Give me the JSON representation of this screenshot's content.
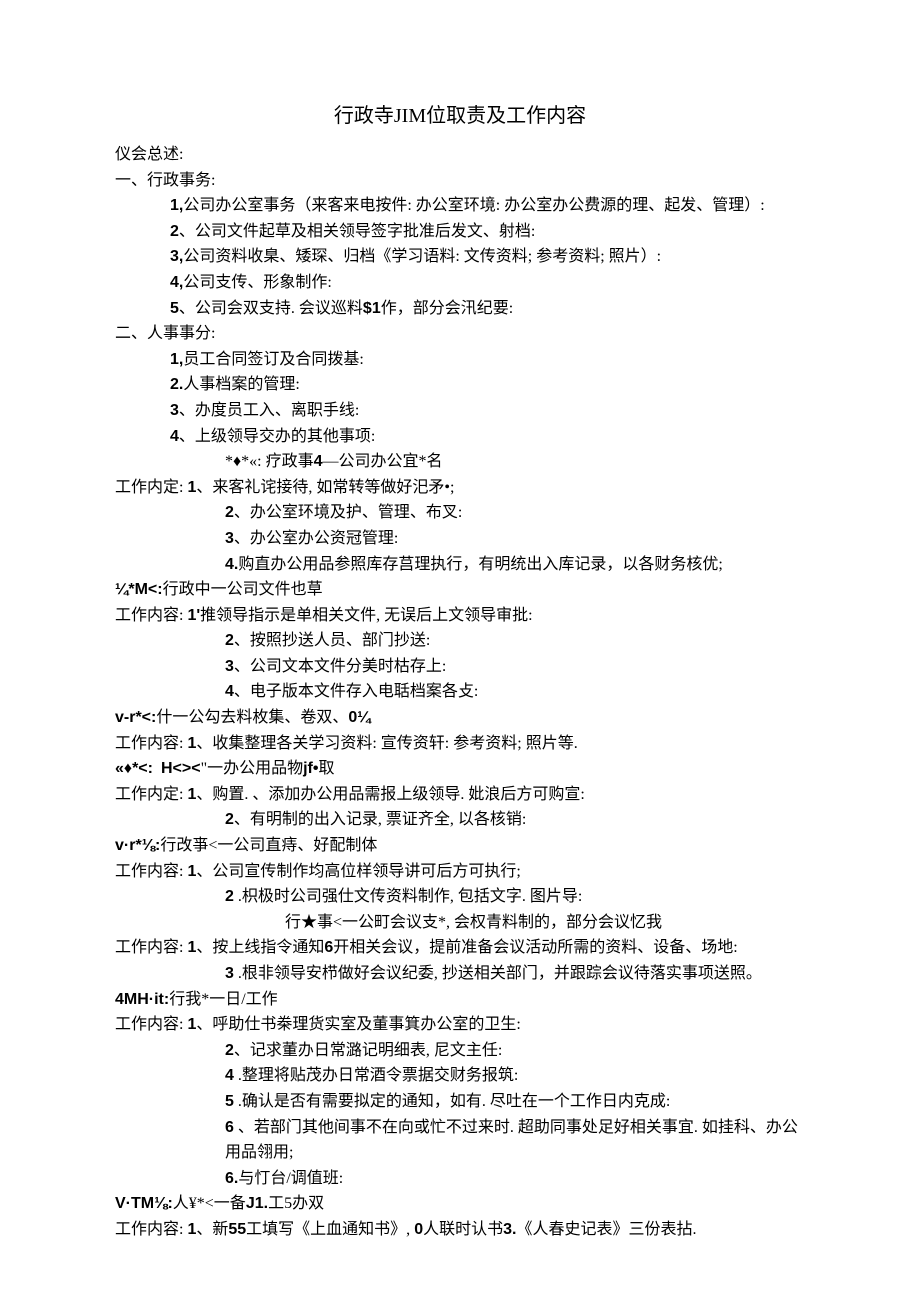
{
  "title": {
    "prefix": "行政寺",
    "mid": "JIM",
    "suffix": "位取责及工作内容"
  },
  "lines": {
    "l0": "仪会总述:",
    "l1": "一、行政事务:",
    "l2n": "1,",
    "l2": "公司办公室事务（来客来电按件: 办公室环境: 办公室办公费源的理、起发、管理）:",
    "l3n": "2",
    "l3": "、公司文件起草及相关领导签字批准后发文、射档:",
    "l4n": "3,",
    "l4": "公司资料收臬、矮琛、归档《学习语料: 文传资料; 参考资料; 照片）:",
    "l5n": "4,",
    "l5": "公司支传、形象制作:",
    "l6n": "5",
    "l6": "、公司会双支持. 会议巡料",
    "l6a": "$1",
    "l6b": "作，部分会汛纪要:",
    "l7": "二、人事事分:",
    "l8n": "1,",
    "l8": "员工合同签订及合同拨基:",
    "l9n": "2.",
    "l9": "人事档案的管理:",
    "l10n": "3",
    "l10": "、办度员工入、离职手线:",
    "l11n": "4",
    "l11": "、上级领导交办的其他事项:",
    "l12a": "*♦*«:",
    "l12b": " 疗政事",
    "l12c": "4",
    "l12d": "—公司办公宜*名",
    "l13": "工作内定: ",
    "l13n": "1",
    "l13b": "、来客礼诧接待, 如常转等做好汜矛•;",
    "l14n": "2",
    "l14": "、办公室环境及护、管理、布叉:",
    "l15n": "3",
    "l15": "、办公室办公资冠管理:",
    "l16n": "4.",
    "l16": "购直办公用品参照库存莒理执行，有明统出入库记录，以各财务核优;",
    "l17a": "¼*M<:",
    "l17b": "行政中一公司文件也草",
    "l18": "工作内容: ",
    "l18n": "1'",
    "l18b": "推领导指示是单相关文件, 无误后上文领导审批:",
    "l19n": "2",
    "l19": "、按照抄送人员、部门抄送:",
    "l20n": "3",
    "l20": "、公司文本文件分美时枯存上:",
    "l21n": "4",
    "l21": "、电子版本文件存入电聒档案各攴:",
    "l22a": "v-r*<:",
    "l22b": "什一公勾去料枚集、卷双、",
    "l22c": "0¼",
    "l23": "工作内容: ",
    "l23n": "1",
    "l23b": "、收集整理各关学习资料: 宣传资轩: 参考资料; 照片等.",
    "l24a": "«♦*<:",
    "l24b": "H<><",
    "l24c": "\"一办公用品物",
    "l24d": "jf•",
    "l24e": "取",
    "l25": "工作内定: ",
    "l25n": "1",
    "l25b": "、购置. 、添加办公用品需报上级领导. 妣浪后方可购宣:",
    "l26n": "2",
    "l26": "、有明制的出入记录, 票证齐全, 以各核销:",
    "l27a": "v·r*⅛:",
    "l27b": "行改亊<一公司直痔、好配制体",
    "l28": "工作内容: ",
    "l28n": "1",
    "l28b": "、公司宣传制作均高位样领导讲可后方可执行;",
    "l29n": "2",
    "l29": " .枳极时公司强仕文传资料制作, 包括文字. 图片导:",
    "l30": "行★事<一公町会议支*, 会权青料制的，部分会议忆我",
    "l31": "工作内容: ",
    "l31n": "1",
    "l31b": "、按上线指令通知",
    "l31c": "6",
    "l31d": "开相关会议，提前准备会议活动所需的资料、设备、场地:",
    "l32n": "3",
    "l32": " .根非领导安栉做好会议纪委, 抄送相关部门，并跟踪会议待落实事项送照。",
    "l33a": "4MH·it:",
    "l33b": "行我*一日/工作",
    "l34": "工作内容: ",
    "l34n": "1",
    "l34b": "、呼助仕书桊理货实室及董事箕办公室的卫生:",
    "l35n": "2",
    "l35": "、记求董办日常潞记明细表, 尼文主任:",
    "l36n": "4",
    "l36": " .整理将贴茂办日常酒令票据交财务报筑:",
    "l37n": "5",
    "l37": " .确认是否有需要拟定的通知，如有. 尽吐在一个工作日内克成:",
    "l38n": "6",
    "l38": " 、若部门其他间事不在向或忙不过来时. 超助同事处足好相关事宜. 如挂科、办公",
    "l38c": "用品翎用;",
    "l39n": "6.",
    "l39": "与忊台/调值班:",
    "l40a": "V·TM⅛:",
    "l40b": "人¥*<一备",
    "l40c": "J1.",
    "l40d": "工5办双",
    "l41": "工作内容: ",
    "l41n": "1",
    "l41b": "、新",
    "l41c": "55",
    "l41d": "工填写《上血通知书》, ",
    "l41e": "0",
    "l41f": "人联时认书",
    "l41g": "3.",
    "l41h": "《人春史记表》三份表拈."
  }
}
